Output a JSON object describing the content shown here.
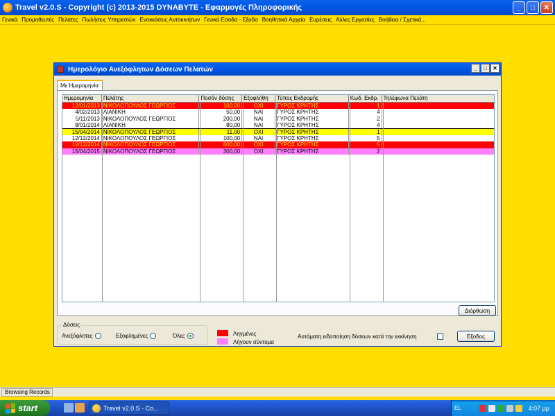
{
  "app": {
    "title": "Travel  v2.0.S  -  Copyright (c)  2013-2015  DYNABYTE  -  Εφαρμογές Πληροφορικής",
    "window_buttons": {
      "minimize": "_",
      "maximize": "□",
      "close": "✕"
    }
  },
  "menu": [
    "Γενικά",
    "Προμηθευτές",
    "Πελάτες",
    "Πωλήσεις Υπηρεσιών",
    "Ενοικιάσεις Αυτοκινήτων",
    "Γενικά Εσοδα - Εξοδα",
    "Βοηθητικά Αρχεία",
    "Ευρέσεις",
    "Αλλες Εργασίες",
    "Βοήθεια / Σχετικά..."
  ],
  "dialog": {
    "title": "Ημερολόγιο Ανεξόφλητων Δόσεων Πελατών",
    "tab_label": "Με Ημερομηνία",
    "columns": [
      "Ημερομηνία",
      "Πελάτης",
      "Ποσόν δόσης",
      "Εξοφλήθη",
      "Τύπος Εκδρομής",
      "Κωδ. Εκδρ.",
      "Τηλέφωνα Πελάτη"
    ],
    "rows": [
      {
        "date": "12/01/2013",
        "customer": "ΝΙΚΟΛΟΠΟΥΛΟΣ ΓΕΩΡΓΙΟΣ",
        "amount": "100,00",
        "paid": "ΟΧΙ",
        "trip": "ΓΥΡΟΣ ΚΡΗΤΗΣ",
        "code": "1",
        "phones": "",
        "style": "red"
      },
      {
        "date": "4/02/2013",
        "customer": "ΛΙΑΝΙΚΗ",
        "amount": "50,00",
        "paid": "ΝΑΙ",
        "trip": "ΓΥΡΟΣ ΚΡΗΤΗΣ",
        "code": "4",
        "phones": "",
        "style": "white"
      },
      {
        "date": "5/11/2013",
        "customer": "ΝΙΚΟΛΟΠΟΥΛΟΣ ΓΕΩΡΓΙΟΣ",
        "amount": "200,00",
        "paid": "ΝΑΙ",
        "trip": "ΓΥΡΟΣ ΚΡΗΤΗΣ",
        "code": "2",
        "phones": "",
        "style": "white"
      },
      {
        "date": "8/01/2014",
        "customer": "ΛΙΑΝΙΚΗ",
        "amount": "80,00",
        "paid": "ΝΑΙ",
        "trip": "ΓΥΡΟΣ ΚΡΗΤΗΣ",
        "code": "4",
        "phones": "",
        "style": "white"
      },
      {
        "date": "15/04/2014",
        "customer": "ΝΙΚΟΛΟΠΟΥΛΟΣ ΓΕΩΡΓΙΟΣ",
        "amount": "11,00",
        "paid": "ΟΧΙ",
        "trip": "ΓΥΡΟΣ ΚΡΗΤΗΣ",
        "code": "1",
        "phones": "",
        "style": "yellow"
      },
      {
        "date": "12/12/2014",
        "customer": "ΝΙΚΟΛΟΠΟΥΛΟΣ ΓΕΩΡΓΙΟΣ",
        "amount": "100,00",
        "paid": "ΝΑΙ",
        "trip": "ΓΥΡΟΣ ΚΡΗΤΗΣ",
        "code": "5",
        "phones": "",
        "style": "white"
      },
      {
        "date": "12/12/2014",
        "customer": "ΝΙΚΟΛΟΠΟΥΛΟΣ ΓΕΩΡΓΙΟΣ",
        "amount": "800,00",
        "paid": "ΟΧΙ",
        "trip": "ΓΥΡΟΣ ΚΡΗΤΗΣ",
        "code": "5",
        "phones": "",
        "style": "red"
      },
      {
        "date": "15/04/2015",
        "customer": "ΝΙΚΟΛΟΠΟΥΛΟΣ ΓΕΩΡΓΙΟΣ",
        "amount": "300,00",
        "paid": "ΟΧΙ",
        "trip": "ΓΥΡΟΣ ΚΡΗΤΗΣ",
        "code": "2",
        "phones": "",
        "style": "pink"
      }
    ],
    "edit_button": "Διόρθωση",
    "installments_group": {
      "legend": "Δόσεις",
      "options": [
        {
          "label": "Ανεξόφλητες",
          "selected": false
        },
        {
          "label": "Εξοφλημένες",
          "selected": false
        },
        {
          "label": "Όλες",
          "selected": true
        }
      ]
    },
    "legend": {
      "expired": "Ληγμένες",
      "expiring_soon": "Λήγουν σύντομα",
      "expired_color": "#FF0000",
      "expiring_color": "#FF80FF"
    },
    "auto_notify_label": "Αυτόματη ειδοποίηση δόσεων κατά την εκκίνηση",
    "auto_notify_checked": false,
    "exit_button": "Εξοδος"
  },
  "statusbar": {
    "text": "Browsing Records"
  },
  "taskbar": {
    "start_label": "start",
    "task_label": "Travel  v2.0.S  - Co...",
    "language": "EL",
    "clock": "4:07 μμ"
  }
}
